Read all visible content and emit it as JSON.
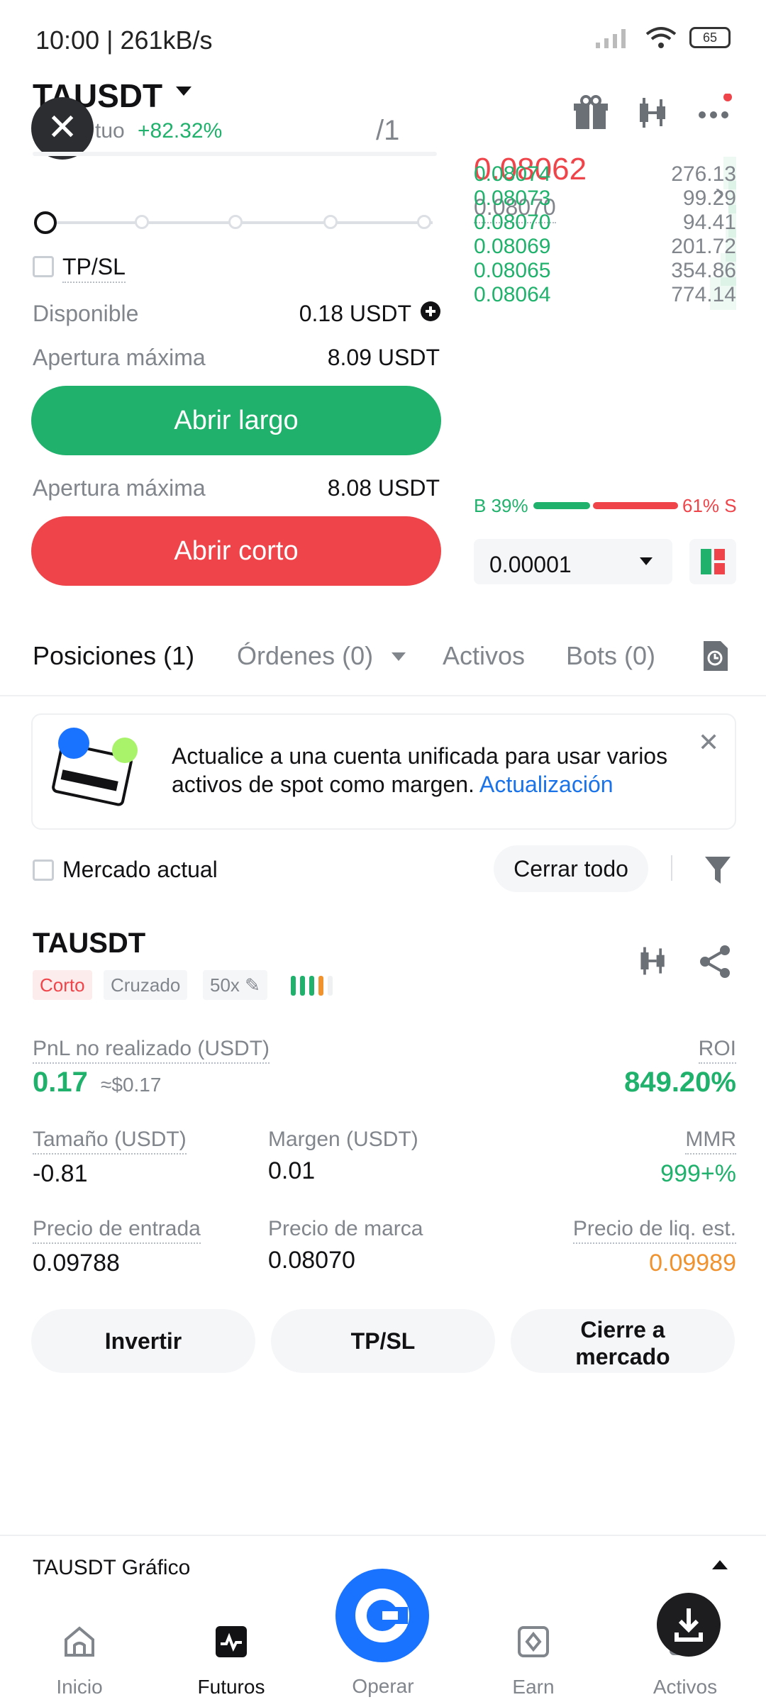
{
  "status_bar": {
    "time_speed": "10:00 | 261kB/s",
    "battery": "65"
  },
  "header": {
    "symbol": "TAUSDT",
    "perp_label": "tuo",
    "change": "+82.32%",
    "leverage_frac": "/1"
  },
  "order_form": {
    "tpsl_label": "TP/SL",
    "available_label": "Disponible",
    "available_value": "0.18 USDT",
    "max_open_label": "Apertura máxima",
    "max_open_long": "8.09 USDT",
    "long_button": "Abrir largo",
    "max_open_short": "8.08 USDT",
    "short_button": "Abrir corto"
  },
  "order_book": {
    "last_price": "0.08062",
    "mark_price": "0.08070",
    "bids": [
      {
        "price": "0.08074",
        "qty": "276.13",
        "depth": 0.05
      },
      {
        "price": "0.08073",
        "qty": "99.29",
        "depth": 0.03
      },
      {
        "price": "0.08070",
        "qty": "94.41",
        "depth": 0.03
      },
      {
        "price": "0.08069",
        "qty": "201.72",
        "depth": 0.04
      },
      {
        "price": "0.08065",
        "qty": "354.86",
        "depth": 0.06
      },
      {
        "price": "0.08064",
        "qty": "774.14",
        "depth": 0.1
      }
    ],
    "buy_ratio": "B 39%",
    "sell_ratio": "61% S",
    "precision": "0.00001"
  },
  "tabs": [
    {
      "label": "Posiciones (1)"
    },
    {
      "label": "Órdenes (0)"
    },
    {
      "label": "Activos"
    },
    {
      "label": "Bots (0)"
    }
  ],
  "banner": {
    "text": "Actualice a una cuenta unificada para usar varios activos de spot como margen. ",
    "link": "Actualización"
  },
  "filters": {
    "current_market": "Mercado actual",
    "close_all": "Cerrar todo"
  },
  "position": {
    "symbol": "TAUSDT",
    "side": "Corto",
    "margin_mode": "Cruzado",
    "leverage": "50x",
    "pnl_label": "PnL no realizado (USDT)",
    "pnl_value": "0.17",
    "pnl_usd": "≈$0.17",
    "roi_label": "ROI",
    "roi_value": "849.20%",
    "size_label": "Tamaño (USDT)",
    "size_value": "-0.81",
    "margin_label": "Margen (USDT)",
    "margin_value": "0.01",
    "mmr_label": "MMR",
    "mmr_value": "999+%",
    "entry_label": "Precio de entrada",
    "entry_value": "0.09788",
    "mark_label": "Precio de marca",
    "mark_value": "0.08070",
    "liq_label": "Precio de liq. est.",
    "liq_value": "0.09989",
    "btn_invert": "Invertir",
    "btn_tpsl": "TP/SL",
    "btn_close_market": "Cierre a mercado"
  },
  "chart_bar": {
    "label": "TAUSDT Gráfico"
  },
  "nav": [
    {
      "label": "Inicio"
    },
    {
      "label": "Futuros"
    },
    {
      "label": "Operar"
    },
    {
      "label": "Earn"
    },
    {
      "label": "Activos"
    }
  ],
  "colors": {
    "green": "#20b26c",
    "red": "#ef454a",
    "orange": "#f0922e",
    "blue": "#1a73ff"
  }
}
